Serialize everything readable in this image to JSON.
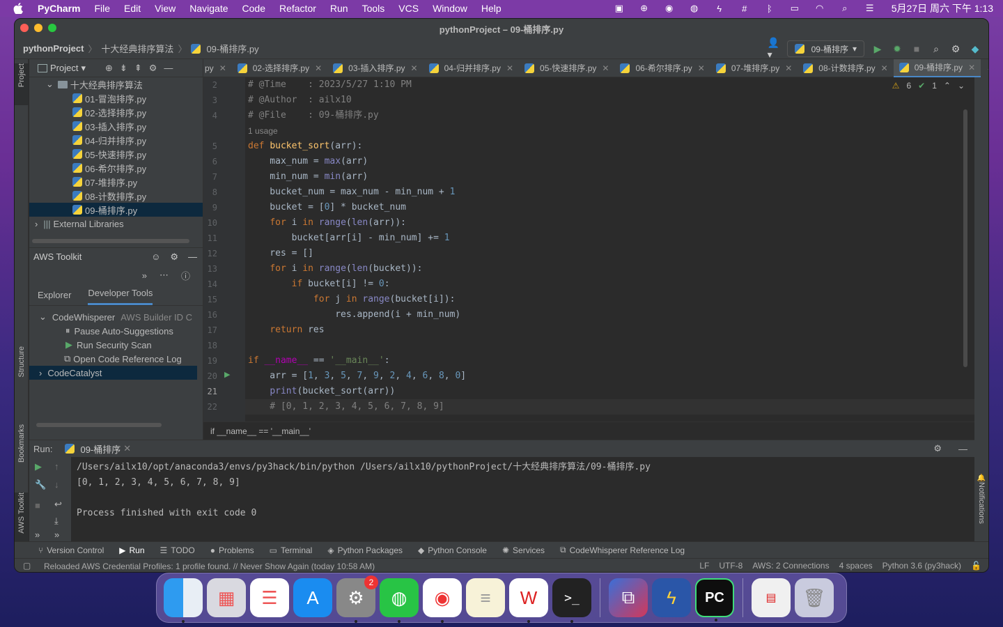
{
  "menubar": {
    "app_name": "PyCharm",
    "items": [
      "File",
      "Edit",
      "View",
      "Navigate",
      "Code",
      "Refactor",
      "Run",
      "Tools",
      "VCS",
      "Window",
      "Help"
    ],
    "clock": "5月27日 周六 下午 1:13"
  },
  "window": {
    "title": "pythonProject – 09-桶排序.py",
    "breadcrumb": [
      "pythonProject",
      "十大经典排序算法",
      "09-桶排序.py"
    ],
    "run_config": "09-桶排序"
  },
  "project_panel": {
    "title": "Project",
    "folder": "十大经典排序算法",
    "files": [
      "01-冒泡排序.py",
      "02-选择排序.py",
      "03-插入排序.py",
      "04-归并排序.py",
      "05-快速排序.py",
      "06-希尔排序.py",
      "07-堆排序.py",
      "08-计数排序.py",
      "09-桶排序.py"
    ],
    "external": "External Libraries"
  },
  "aws_toolkit": {
    "title": "AWS Toolkit",
    "tabs": [
      "Explorer",
      "Developer Tools"
    ],
    "codewhisperer": "CodeWhisperer",
    "builder_id": "AWS Builder ID C",
    "items": [
      "Pause Auto-Suggestions",
      "Run Security Scan",
      "Open Code Reference Log"
    ],
    "codecatalyst": "CodeCatalyst"
  },
  "side_tabs": {
    "project": "Project",
    "structure": "Structure",
    "bookmarks": "Bookmarks",
    "aws": "AWS Toolkit",
    "notifications": "Notifications"
  },
  "editor_tabs": [
    "02-选择排序.py",
    "03-插入排序.py",
    "04-归并排序.py",
    "05-快速排序.py",
    "06-希尔排序.py",
    "07-堆排序.py",
    "08-计数排序.py",
    "09-桶排序.py"
  ],
  "editor_tab_prefix": "py",
  "inspections": {
    "warnings": "6",
    "ok": "1"
  },
  "editor": {
    "usage_hint": "1 usage",
    "line_numbers": [
      "2",
      "3",
      "4",
      "5",
      "6",
      "7",
      "8",
      "9",
      "10",
      "11",
      "12",
      "13",
      "14",
      "15",
      "16",
      "17",
      "18",
      "19",
      "20",
      "21",
      "22"
    ],
    "current_line": "21",
    "breadcrumb": "if __name__ == '__main__'"
  },
  "run_panel": {
    "label": "Run:",
    "tab": "09-桶排序",
    "output": [
      "/Users/ailx10/opt/anaconda3/envs/py3hack/bin/python /Users/ailx10/pythonProject/十大经典排序算法/09-桶排序.py",
      "[0, 1, 2, 3, 4, 5, 6, 7, 8, 9]",
      "",
      "Process finished with exit code 0"
    ]
  },
  "bottom_tabs": [
    "Version Control",
    "Run",
    "TODO",
    "Problems",
    "Terminal",
    "Python Packages",
    "Python Console",
    "Services",
    "CodeWhisperer Reference Log"
  ],
  "status": {
    "message": "Reloaded AWS Credential Profiles: 1 profile found. // Never Show Again (today 10:58 AM)",
    "right": [
      "LF",
      "UTF-8",
      "AWS: 2 Connections",
      "4 spaces",
      "Python 3.6 (py3hack)"
    ]
  },
  "colors": {
    "keyword": "#cc7832",
    "function": "#ffc66d",
    "number": "#6897bb",
    "comment": "#808080",
    "builtin": "#8888c6",
    "string": "#6a8759",
    "selection": "#0d293e",
    "accent": "#4a88c7"
  }
}
